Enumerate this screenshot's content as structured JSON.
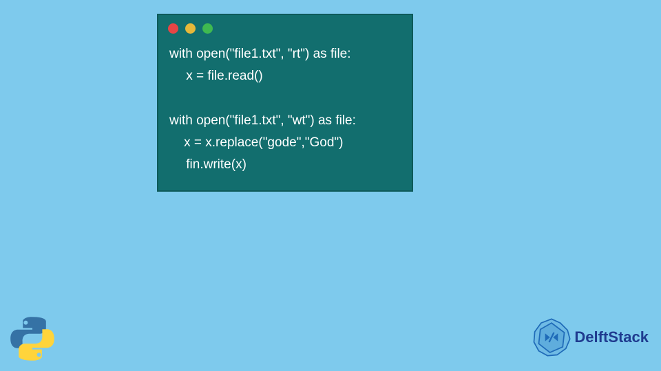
{
  "colors": {
    "background": "#7ecaed",
    "window_bg": "#126e6e",
    "code_text": "#ffffff",
    "brand_text": "#1f3b8f",
    "dot_red": "#e64545",
    "dot_yellow": "#e6b83a",
    "dot_green": "#3fb950"
  },
  "code": {
    "line1": "with open(\"file1.txt\", \"rt\") as file:",
    "line2": "  x = file.read()",
    "line3": "  ",
    "line4": "with open(\"file1.txt\", \"wt\") as file:",
    "line5": "    x = x.replace(\"gode\",\"God\")",
    "line6": "  fin.write(x)"
  },
  "brand": {
    "name": "DelftStack"
  },
  "icons": {
    "python": "python-logo",
    "delft": "delft-emblem"
  }
}
